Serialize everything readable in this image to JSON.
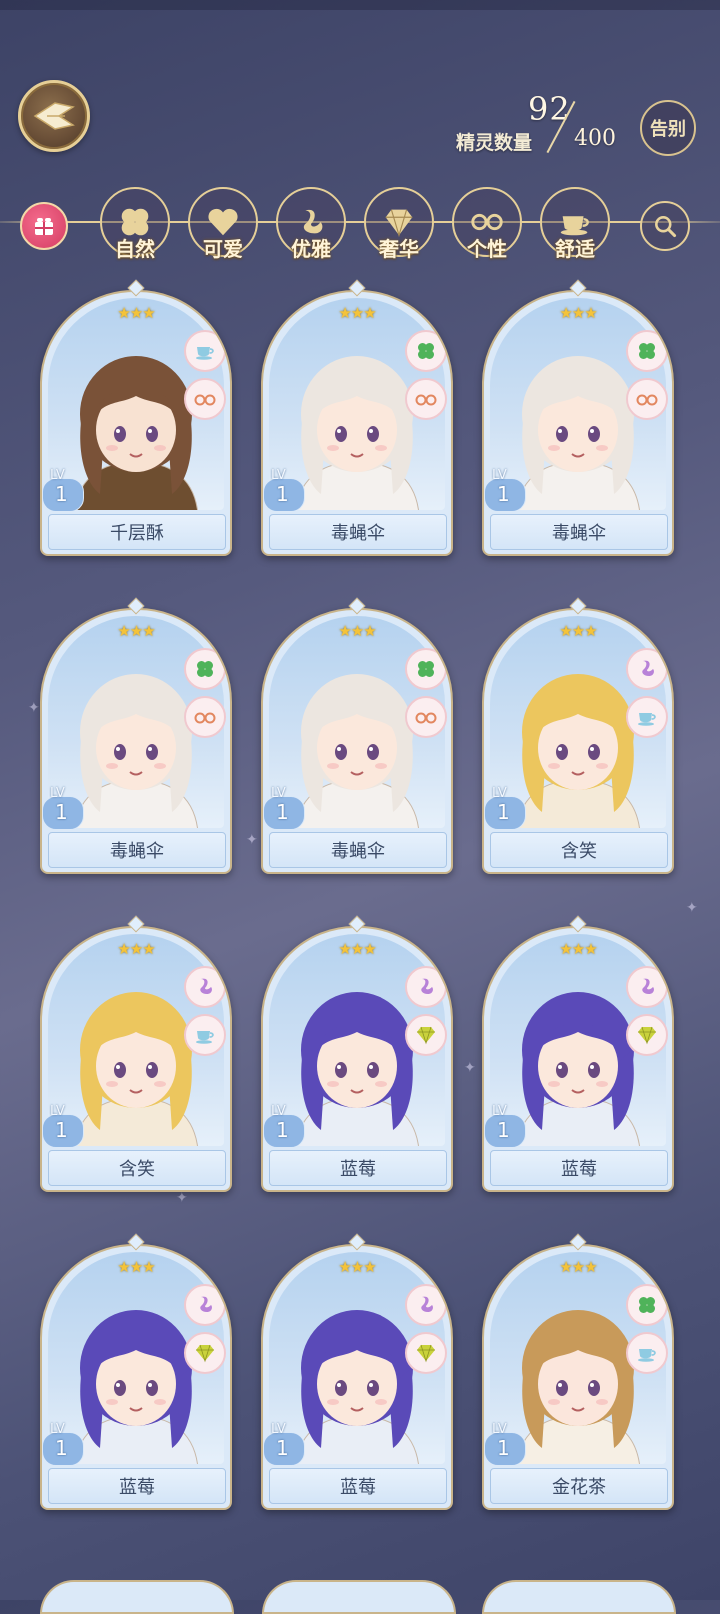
{
  "header": {
    "sprite_count_label": "精灵数量",
    "sprite_count_current": "92",
    "sprite_count_max": "400",
    "farewell_label": "告别"
  },
  "filters": [
    {
      "label": "自然",
      "icon": "clover-icon"
    },
    {
      "label": "可爱",
      "icon": "heart-icon"
    },
    {
      "label": "优雅",
      "icon": "swan-icon"
    },
    {
      "label": "奢华",
      "icon": "diamond-icon"
    },
    {
      "label": "个性",
      "icon": "glasses-icon"
    },
    {
      "label": "舒适",
      "icon": "teacup-icon"
    }
  ],
  "colors": {
    "accent_gold": "#e5cf98",
    "card_bg": "#dbe9f8",
    "star": "#f4c33a"
  },
  "cards": [
    {
      "name": "千层酥",
      "level": "1",
      "lv_label": "LV",
      "stars": "★★★",
      "traits": [
        "teacup-icon",
        "glasses-icon"
      ],
      "hair": "#7a5238",
      "outfit": "#6e4e30",
      "skin": "#f8e2d2"
    },
    {
      "name": "毒蝇伞",
      "level": "1",
      "lv_label": "LV",
      "stars": "★★★",
      "traits": [
        "clover-icon",
        "glasses-icon"
      ],
      "hair": "#ece6e0",
      "outfit": "#f4f1ee",
      "skin": "#fbe8dc"
    },
    {
      "name": "毒蝇伞",
      "level": "1",
      "lv_label": "LV",
      "stars": "★★★",
      "traits": [
        "clover-icon",
        "glasses-icon"
      ],
      "hair": "#ece6e0",
      "outfit": "#f4f1ee",
      "skin": "#fbe8dc"
    },
    {
      "name": "毒蝇伞",
      "level": "1",
      "lv_label": "LV",
      "stars": "★★★",
      "traits": [
        "clover-icon",
        "glasses-icon"
      ],
      "hair": "#ece6e0",
      "outfit": "#f4f1ee",
      "skin": "#fbe8dc"
    },
    {
      "name": "毒蝇伞",
      "level": "1",
      "lv_label": "LV",
      "stars": "★★★",
      "traits": [
        "clover-icon",
        "glasses-icon"
      ],
      "hair": "#ece6e0",
      "outfit": "#f4f1ee",
      "skin": "#fbe8dc"
    },
    {
      "name": "含笑",
      "level": "1",
      "lv_label": "LV",
      "stars": "★★★",
      "traits": [
        "swan-icon",
        "teacup-icon"
      ],
      "hair": "#ecc65e",
      "outfit": "#f4ead8",
      "skin": "#fbe8dc"
    },
    {
      "name": "含笑",
      "level": "1",
      "lv_label": "LV",
      "stars": "★★★",
      "traits": [
        "swan-icon",
        "teacup-icon"
      ],
      "hair": "#ecc65e",
      "outfit": "#f4ead8",
      "skin": "#fbe8dc"
    },
    {
      "name": "蓝莓",
      "level": "1",
      "lv_label": "LV",
      "stars": "★★★",
      "traits": [
        "swan-icon",
        "diamond-icon"
      ],
      "hair": "#5a4ab8",
      "outfit": "#e9eef6",
      "skin": "#fbe8dc"
    },
    {
      "name": "蓝莓",
      "level": "1",
      "lv_label": "LV",
      "stars": "★★★",
      "traits": [
        "swan-icon",
        "diamond-icon"
      ],
      "hair": "#5a4ab8",
      "outfit": "#e9eef6",
      "skin": "#fbe8dc"
    },
    {
      "name": "蓝莓",
      "level": "1",
      "lv_label": "LV",
      "stars": "★★★",
      "traits": [
        "swan-icon",
        "diamond-icon"
      ],
      "hair": "#5a4ab8",
      "outfit": "#e9eef6",
      "skin": "#fbe8dc"
    },
    {
      "name": "蓝莓",
      "level": "1",
      "lv_label": "LV",
      "stars": "★★★",
      "traits": [
        "swan-icon",
        "diamond-icon"
      ],
      "hair": "#5a4ab8",
      "outfit": "#e9eef6",
      "skin": "#fbe8dc"
    },
    {
      "name": "金花茶",
      "level": "1",
      "lv_label": "LV",
      "stars": "★★★",
      "traits": [
        "clover-icon",
        "teacup-icon"
      ],
      "hair": "#c89a5a",
      "outfit": "#f6efe4",
      "skin": "#fbe6dc"
    }
  ]
}
